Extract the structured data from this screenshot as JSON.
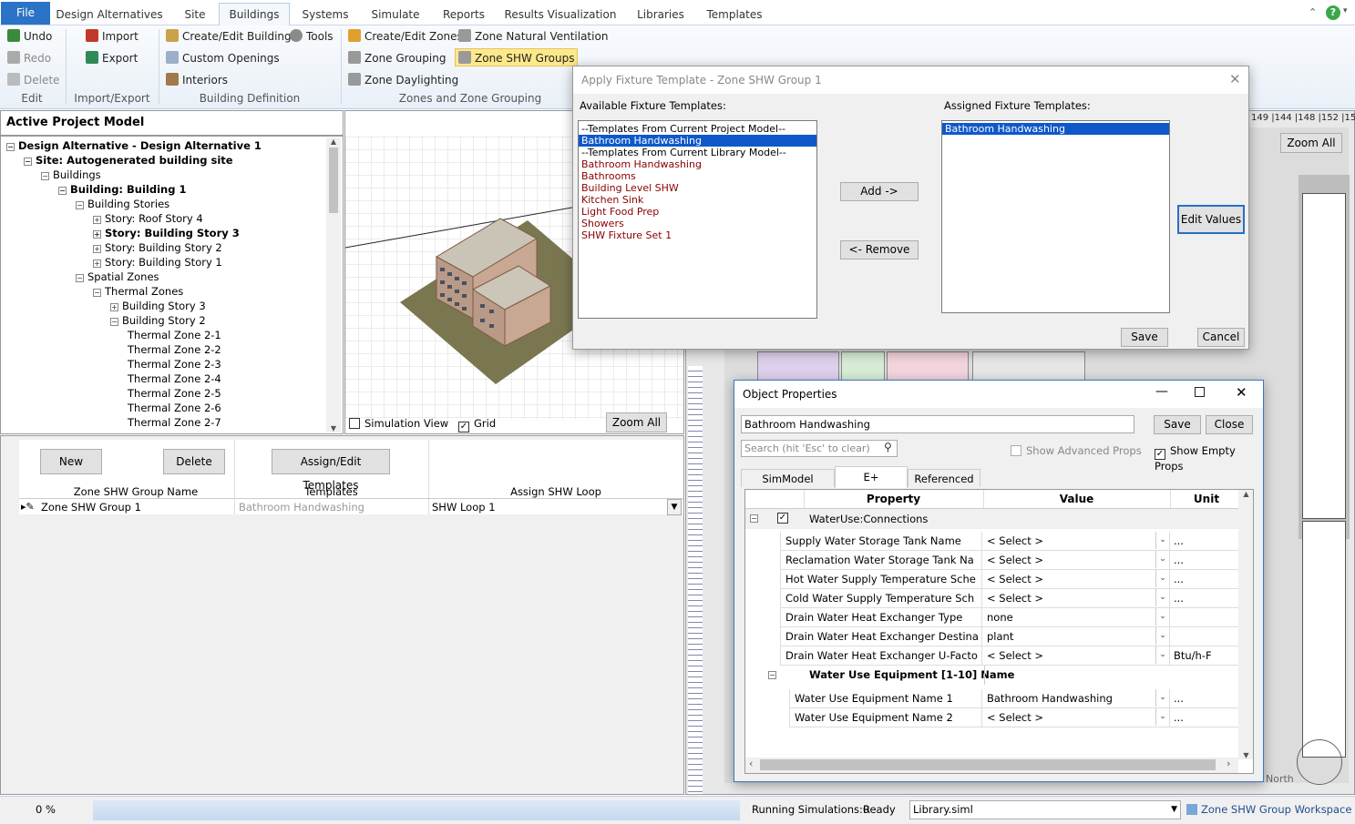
{
  "menu": {
    "file": "File",
    "tabs": [
      "Design Alternatives",
      "Site",
      "Buildings",
      "Systems",
      "Simulate",
      "Reports",
      "Results Visualization",
      "Libraries",
      "Templates"
    ],
    "selected": "Buildings"
  },
  "ribbon": {
    "undo": "Undo",
    "redo": "Redo",
    "delete": "Delete",
    "edit_group": "Edit",
    "import": "Import",
    "export": "Export",
    "ie_group": "Import/Export",
    "create_edit_buildings": "Create/Edit Buildings",
    "tools": "Tools",
    "custom_openings": "Custom Openings",
    "interiors": "Interiors",
    "bd_group": "Building Definition",
    "create_edit_zones": "Create/Edit Zones",
    "zone_natural_ventilation": "Zone Natural Ventilation",
    "zone_grouping": "Zone Grouping",
    "zone_shw_groups": "Zone SHW Groups",
    "zone_daylighting": "Zone Daylighting",
    "zz_group": "Zones and Zone Grouping"
  },
  "tree": {
    "title": "Active Project Model",
    "items": [
      {
        "indent": 0,
        "pm": "−",
        "text": "Design Alternative - Design Alternative 1",
        "bold": true
      },
      {
        "indent": 1,
        "pm": "−",
        "text": "Site: Autogenerated building site",
        "bold": true
      },
      {
        "indent": 2,
        "pm": "−",
        "text": "Buildings",
        "bold": false
      },
      {
        "indent": 3,
        "pm": "−",
        "text": "Building: Building  1",
        "bold": true
      },
      {
        "indent": 4,
        "pm": "−",
        "text": "Building Stories",
        "bold": false
      },
      {
        "indent": 5,
        "pm": "+",
        "text": "Story: Roof Story 4",
        "bold": false
      },
      {
        "indent": 5,
        "pm": "+",
        "text": "Story: Building Story 3",
        "bold": true
      },
      {
        "indent": 5,
        "pm": "+",
        "text": "Story: Building Story 2",
        "bold": false
      },
      {
        "indent": 5,
        "pm": "+",
        "text": "Story: Building Story 1",
        "bold": false
      },
      {
        "indent": 4,
        "pm": "−",
        "text": "Spatial Zones",
        "bold": false
      },
      {
        "indent": 5,
        "pm": "−",
        "text": "Thermal Zones",
        "bold": false
      },
      {
        "indent": 6,
        "pm": "+",
        "text": "Building Story 3",
        "bold": false
      },
      {
        "indent": 6,
        "pm": "−",
        "text": "Building Story 2",
        "bold": false
      },
      {
        "indent": 7,
        "pm": "",
        "text": "Thermal Zone 2-1",
        "bold": false
      },
      {
        "indent": 7,
        "pm": "",
        "text": "Thermal Zone 2-2",
        "bold": false
      },
      {
        "indent": 7,
        "pm": "",
        "text": "Thermal Zone 2-3",
        "bold": false
      },
      {
        "indent": 7,
        "pm": "",
        "text": "Thermal Zone 2-4",
        "bold": false
      },
      {
        "indent": 7,
        "pm": "",
        "text": "Thermal Zone 2-5",
        "bold": false
      },
      {
        "indent": 7,
        "pm": "",
        "text": "Thermal Zone 2-6",
        "bold": false
      },
      {
        "indent": 7,
        "pm": "",
        "text": "Thermal Zone 2-7",
        "bold": false
      }
    ]
  },
  "view3d": {
    "simulation_view": "Simulation View",
    "grid": "Grid",
    "zoom_all": "Zoom All"
  },
  "shw": {
    "new": "New",
    "delete": "Delete",
    "assign_edit": "Assign/Edit Templates",
    "col_name": "Zone SHW Group Name",
    "col_templates": "Templates",
    "col_loop": "Assign SHW Loop",
    "row_name": "Zone SHW Group 1",
    "row_templates": "Bathroom Handwashing",
    "row_loop": "SHW Loop 1"
  },
  "plan": {
    "zoom_all": "Zoom All",
    "north": "North",
    "ruler_top": "149 |144 |148 |152 |15"
  },
  "fixture_dialog": {
    "title": "Apply Fixture Template - Zone SHW Group 1",
    "available_label": "Available Fixture Templates:",
    "assigned_label": "Assigned Fixture Templates:",
    "available": [
      {
        "text": "--Templates From Current Project Model--",
        "type": "hdr"
      },
      {
        "text": "Bathroom Handwashing",
        "type": "sel"
      },
      {
        "text": "--Templates From Current Library Model--",
        "type": "hdr"
      },
      {
        "text": "Bathroom Handwashing",
        "type": "item"
      },
      {
        "text": "Bathrooms",
        "type": "item"
      },
      {
        "text": "Building Level SHW",
        "type": "item"
      },
      {
        "text": "Kitchen Sink",
        "type": "item"
      },
      {
        "text": "Light Food Prep",
        "type": "item"
      },
      {
        "text": "Showers",
        "type": "item"
      },
      {
        "text": "SHW Fixture Set 1",
        "type": "item"
      }
    ],
    "assigned": [
      "Bathroom Handwashing"
    ],
    "add": "Add ->",
    "remove": "<- Remove",
    "edit_values": "Edit Values",
    "save": "Save",
    "cancel": "Cancel"
  },
  "obj_props": {
    "title": "Object Properties",
    "name_value": "Bathroom Handwashing",
    "save": "Save",
    "close": "Close",
    "search_placeholder": "Search (hit 'Esc' to clear)",
    "show_advanced": "Show Advanced Props",
    "show_empty": "Show Empty Props",
    "tabs": [
      "SimModel Properties",
      "E+ Properties",
      "Referenced By"
    ],
    "col_property": "Property",
    "col_value": "Value",
    "col_unit": "Unit",
    "group1": "WaterUse:Connections",
    "rows1": [
      {
        "p": "Supply Water Storage Tank Name",
        "v": "< Select >",
        "u": "...",
        "dd": true
      },
      {
        "p": "Reclamation Water Storage Tank Na",
        "v": "< Select >",
        "u": "...",
        "dd": true
      },
      {
        "p": "Hot Water Supply Temperature Sche",
        "v": "< Select >",
        "u": "...",
        "dd": true
      },
      {
        "p": "Cold Water Supply Temperature Sch",
        "v": "< Select >",
        "u": "...",
        "dd": true
      },
      {
        "p": "Drain Water Heat Exchanger Type",
        "v": "none",
        "u": "",
        "dd": true
      },
      {
        "p": "Drain Water Heat Exchanger Destina",
        "v": "plant",
        "u": "",
        "dd": true
      },
      {
        "p": "Drain Water Heat Exchanger U-Facto",
        "v": "< Select >",
        "u": "Btu/h-F",
        "dd": true
      }
    ],
    "group2": "Water Use Equipment [1-10] Name",
    "rows2": [
      {
        "p": "Water Use Equipment Name 1",
        "v": "Bathroom Handwashing",
        "u": "...",
        "dd": true
      },
      {
        "p": "Water Use Equipment Name 2",
        "v": "< Select >",
        "u": "...",
        "dd": true
      }
    ]
  },
  "status": {
    "progress": "0 %",
    "running": "Running Simulations:0",
    "ready": "Ready",
    "library": "Library.siml",
    "workspace": "Zone SHW Group Workspace"
  }
}
